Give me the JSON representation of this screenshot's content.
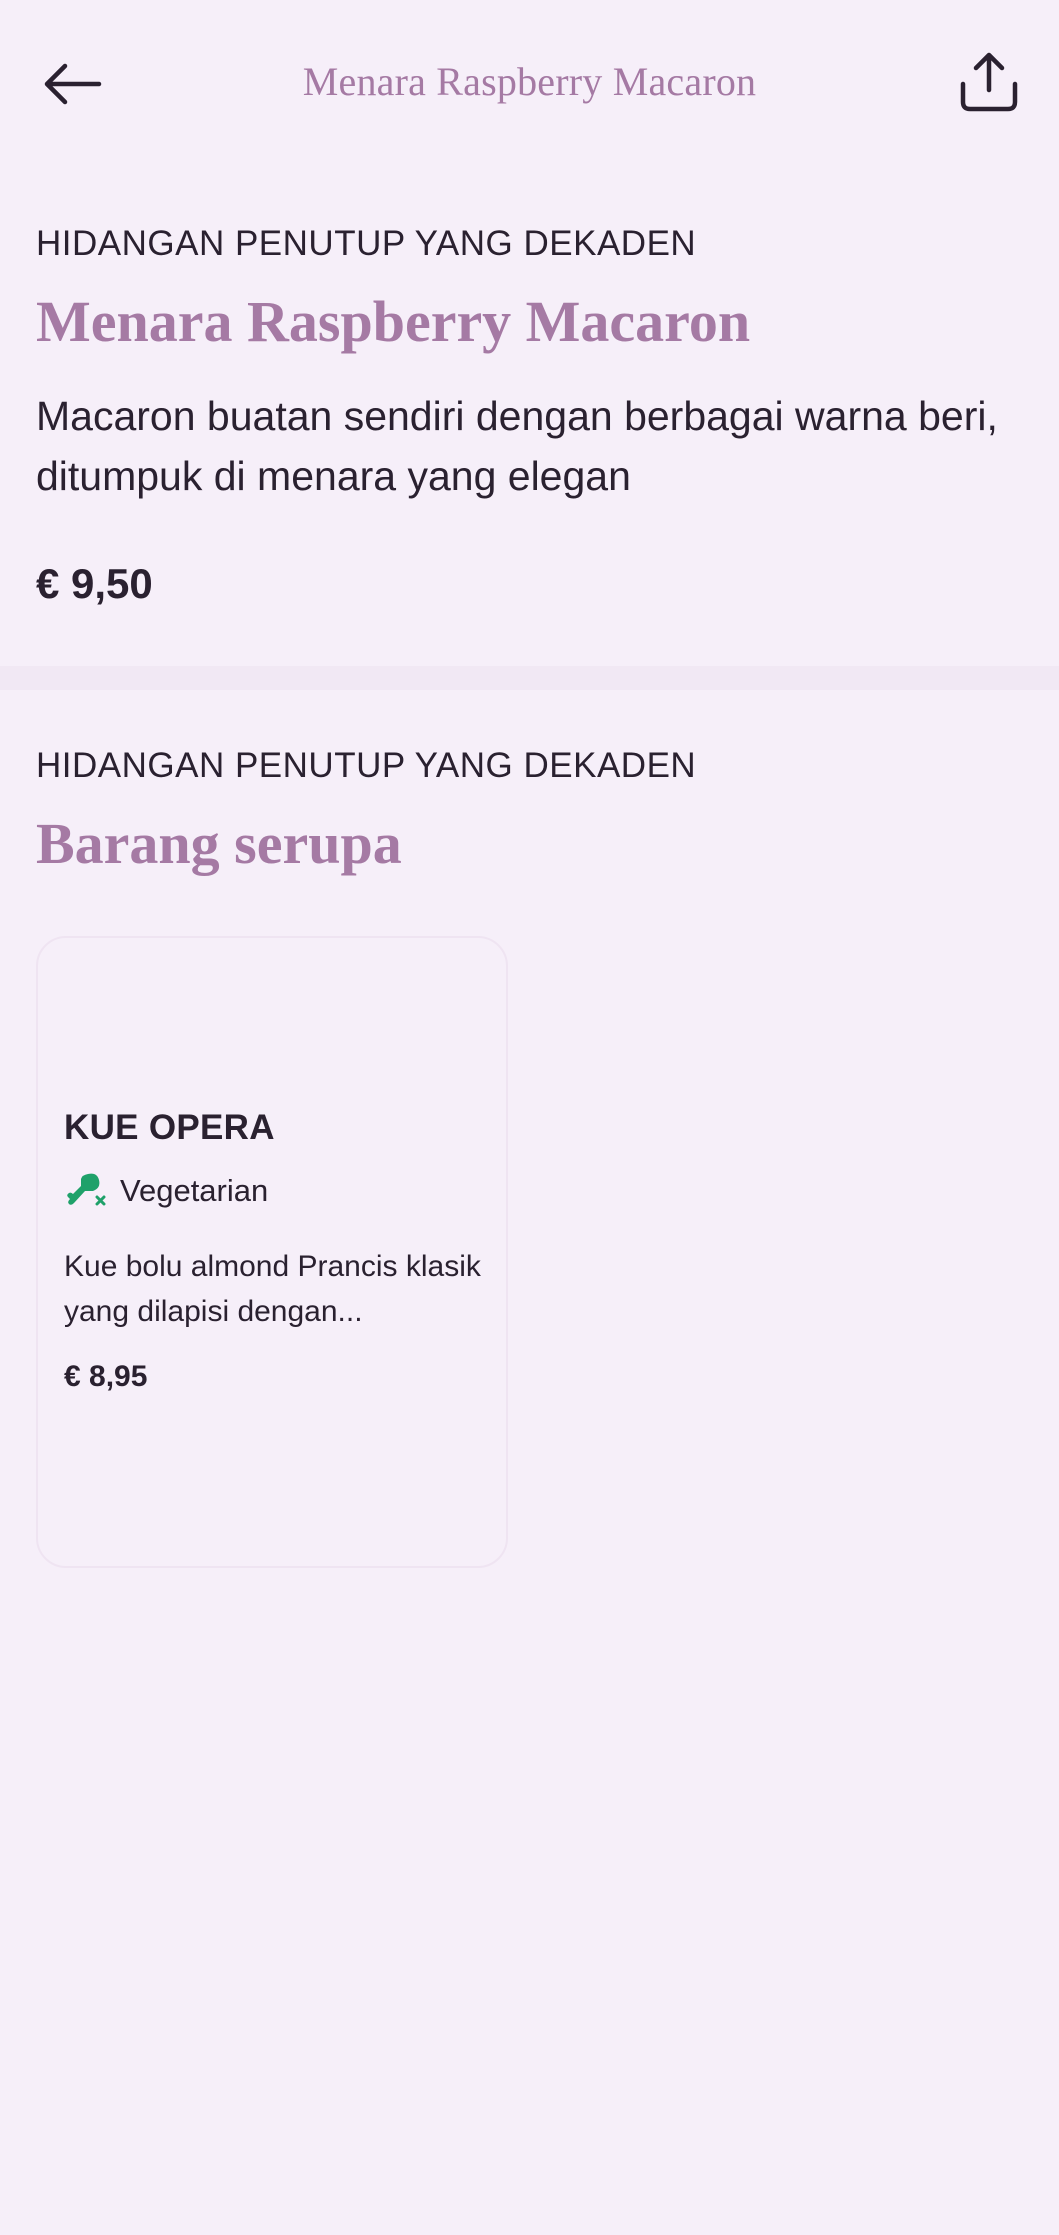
{
  "topbar": {
    "title": "Menara Raspberry Macaron",
    "back_icon": "arrow-left-icon",
    "share_icon": "share-icon"
  },
  "product": {
    "category": "HIDANGAN PENUTUP YANG DEKADEN",
    "name": "Menara Raspberry Macaron",
    "description": "Macaron buatan sendiri dengan berbagai warna beri, ditumpuk di menara yang elegan",
    "price": "€ 9,50"
  },
  "similar": {
    "category": "HIDANGAN PENUTUP YANG DEKADEN",
    "heading": "Barang serupa",
    "items": [
      {
        "name": "KUE OPERA",
        "diet_label": "Vegetarian",
        "diet_icon": "no-meat-icon",
        "description": "Kue bolu almond Prancis klasik yang dilapisi dengan...",
        "price": "€ 8,95"
      }
    ]
  },
  "colors": {
    "background": "#f6eff9",
    "accent": "#a57aa4",
    "text": "#2a2130",
    "diet_green": "#1fa16a"
  }
}
